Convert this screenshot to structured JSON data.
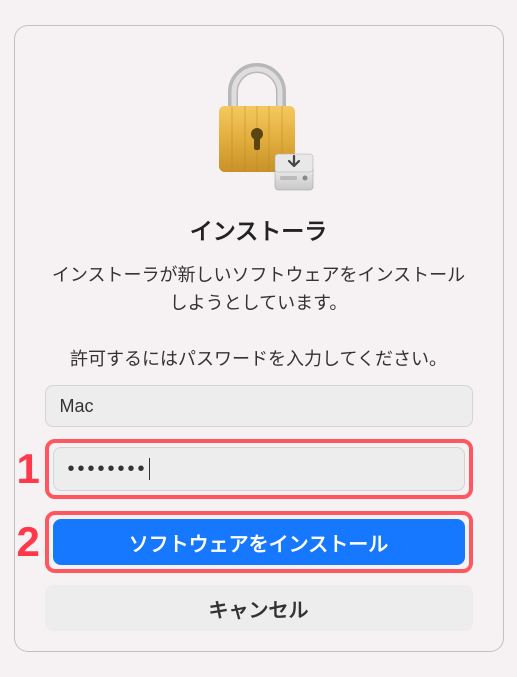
{
  "dialog": {
    "title": "インストーラ",
    "subtitle": "インストーラが新しいソフトウェアをインストールしようとしています。",
    "instruction": "許可するにはパスワードを入力してください。",
    "username_value": "Mac",
    "password_mask": "••••••••",
    "install_button": "ソフトウェアをインストール",
    "cancel_button": "キャンセル"
  },
  "annotations": {
    "one": "1",
    "two": "2"
  }
}
